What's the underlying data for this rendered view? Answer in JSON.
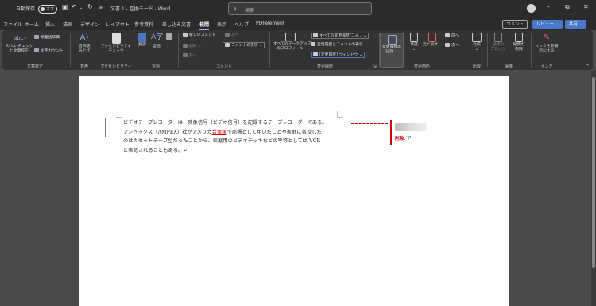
{
  "titlebar": {
    "autosave_label": "自動保存",
    "autosave_state": "オフ",
    "doc_title": "文書 1 - 互換モード - Word",
    "search_placeholder": "検索",
    "search_icon": "search-icon"
  },
  "tabs": [
    "ファイル",
    "ホーム",
    "挿入",
    "描画",
    "デザイン",
    "レイアウト",
    "参考資料",
    "差し込み文書",
    "校閲",
    "表示",
    "ヘルプ",
    "PDFelement"
  ],
  "tab_buttons": {
    "comment": "コメント",
    "review": "レビュー",
    "share": "共有"
  },
  "ribbon": {
    "proofing": {
      "label": "文章校正",
      "spell_check": "スペル チェック\nと文章校正",
      "thesaurus": "類義語辞典",
      "word_count": "文字カウント"
    },
    "speech": {
      "label": "音声",
      "read_aloud": "音声読\nみ上げ"
    },
    "accessibility": {
      "label": "アクセシビリティ",
      "check": "アクセシビリティ\nチェック"
    },
    "language": {
      "label": "言語",
      "translate": "翻訳",
      "language": "言語"
    },
    "comments": {
      "label": "コメント",
      "new_comment": "新しいコメント",
      "delete": "削除",
      "prev": "前へ",
      "next": "次へ",
      "show_comments": "コメントの表示"
    },
    "tracking": {
      "label": "変更履歴",
      "all_markup": "すべての変更履歴/コメ...",
      "show_markup": "変更履歴とコメントの表示",
      "track_changes": "[変更履歴] ウィンドウ",
      "markup_options": "すべてのマークアップ\nのプロフィール",
      "record": "変更履歴の\n記録"
    },
    "changes": {
      "label": "変更箇所",
      "accept": "承諾",
      "reject": "元に戻す",
      "previous": "前へ",
      "next": "次へ"
    },
    "compare": {
      "label": "比較",
      "compare": "比較"
    },
    "protect": {
      "label": "保護",
      "block_authors": "編集の\nブロック",
      "restrict": "編集の\n制限"
    },
    "ink": {
      "label": "インク",
      "hide_ink": "インクを非表\n示にする"
    }
  },
  "document": {
    "lines": [
      "ビデオテープレコーダーは、映像信号（ビデオ信号）を記録するテープレコーダーである。",
      "アンペックス（AMPEX）社がアメリカ",
      "合衆国",
      "で商標として用いたことや家庭に普及した",
      "のはカセットテープ型だったことから、家庭用のビデオデッキなどの呼称としては VCR",
      "と表記されることもある。↵"
    ],
    "balloon_label": "削除:",
    "balloon_text": "ア"
  }
}
